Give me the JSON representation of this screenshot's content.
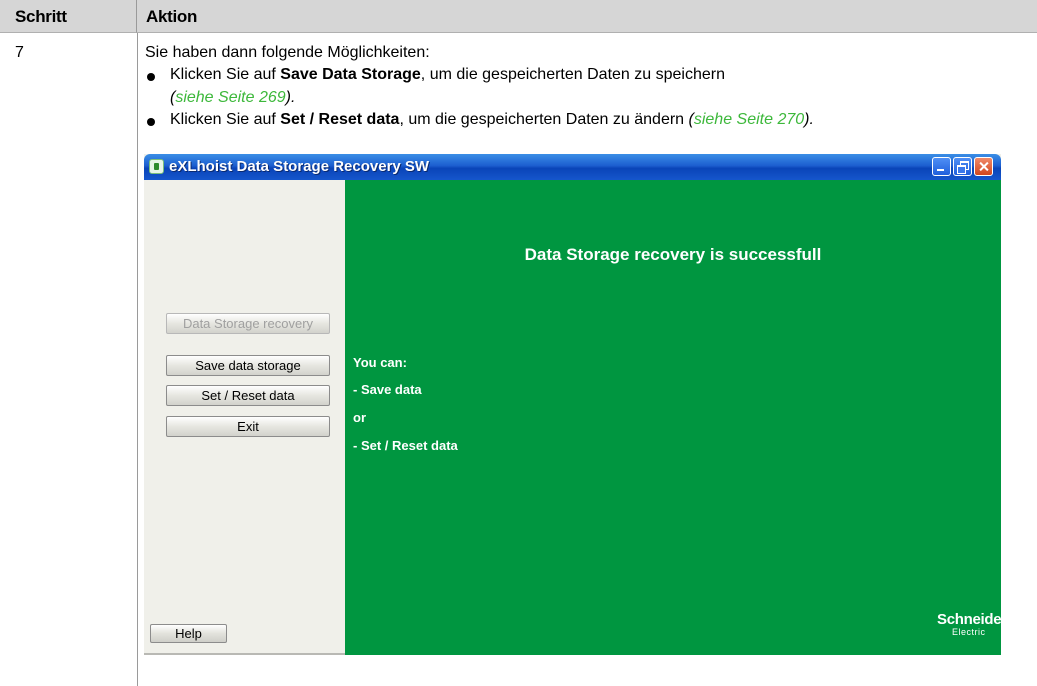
{
  "table": {
    "headers": {
      "step": "Schritt",
      "action": "Aktion"
    },
    "step_number": "7",
    "intro": "Sie haben dann folgende Möglichkeiten:",
    "bullets": [
      {
        "prefix": "Klicken Sie auf ",
        "bold": "Save Data Storage",
        "suffix": ", um die gespeicherten Daten zu speichern",
        "link_open": "(",
        "link_text": "siehe Seite 269",
        "link_close": ")."
      },
      {
        "prefix": "Klicken Sie auf ",
        "bold": "Set / Reset data",
        "suffix": ", um die gespeicherten Daten zu ändern ",
        "link_open": "(",
        "link_text": "siehe Seite 270",
        "link_close": ")."
      }
    ]
  },
  "app_window": {
    "title": "eXLhoist Data Storage Recovery SW",
    "buttons": {
      "data_storage_recovery": "Data Storage recovery",
      "save_data_storage": "Save data storage",
      "set_reset_data": "Set / Reset data",
      "exit": "Exit",
      "help": "Help"
    },
    "status_title": "Data Storage recovery is successfull",
    "messages": [
      "You can:",
      "- Save data",
      "or",
      "- Set / Reset data"
    ],
    "brand": {
      "name": "Schneider",
      "sub": "Electric"
    },
    "colors": {
      "panel_green": "#009640",
      "title_bar_blue": "#1c5ed0",
      "link_green": "#3db83b"
    }
  }
}
